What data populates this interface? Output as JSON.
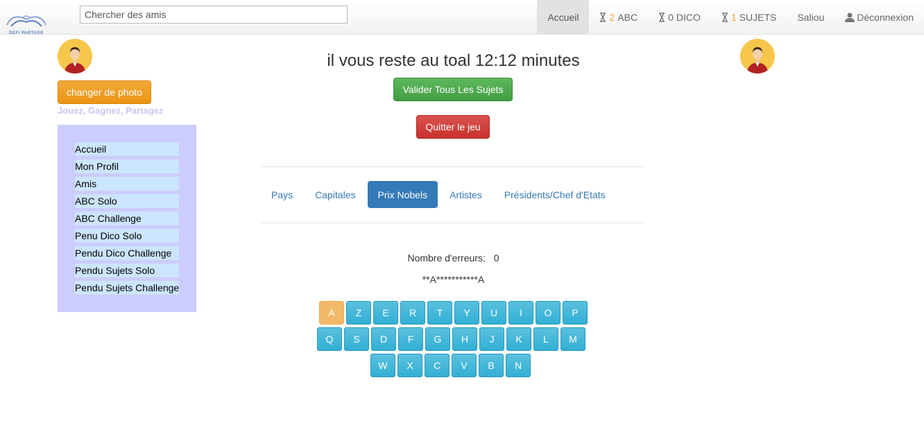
{
  "logo": {
    "text": "DEFI PARTAGE"
  },
  "search": {
    "placeholder": "Chercher des amis"
  },
  "nav": {
    "accueil": "Accueil",
    "abc_count": "2",
    "abc_label": "ABC",
    "dico_count": "0",
    "dico_label": "DICO",
    "sujets_count": "1",
    "sujets_label": "SUJETS",
    "user": "Saliou",
    "logout": "Déconnexion"
  },
  "profile": {
    "change_photo": "changer de photo",
    "tagline": "Jouez, Gagnez, Partagez"
  },
  "sidebar": {
    "items": [
      {
        "label": "Accueil"
      },
      {
        "label": "Mon Profil"
      },
      {
        "label": "Amis"
      },
      {
        "label": "ABC Solo"
      },
      {
        "label": "ABC Challenge"
      },
      {
        "label": "Penu Dico Solo"
      },
      {
        "label": "Pendu Dico Challenge"
      },
      {
        "label": "Pendu Sujets Solo"
      },
      {
        "label": "Pendu Sujets Challenge"
      }
    ]
  },
  "game": {
    "timer_text": "il vous reste au toal 12:12 minutes",
    "validate_label": "Valider Tous Les Sujets",
    "quit_label": "Quitter le jeu",
    "errors_label": "Nombre d'erreurs:",
    "errors_value": "0",
    "word": "**A***********A"
  },
  "tabs": [
    {
      "label": "Pays"
    },
    {
      "label": "Capitales"
    },
    {
      "label": "Prix Nobels",
      "active": true
    },
    {
      "label": "Artistes"
    },
    {
      "label": "Présidents/Chef d'Etats"
    }
  ],
  "keyboard": {
    "row1": [
      "A",
      "Z",
      "E",
      "R",
      "T",
      "Y",
      "U",
      "I",
      "O",
      "P"
    ],
    "row2": [
      "Q",
      "S",
      "D",
      "F",
      "G",
      "H",
      "J",
      "K",
      "L",
      "M"
    ],
    "row3": [
      "W",
      "X",
      "C",
      "V",
      "B",
      "N"
    ],
    "used": [
      "A"
    ]
  },
  "colors": {
    "accent": "#337ab7",
    "sidebar_bg": "#ccccff",
    "sidebar_item_bg": "#cce5ff",
    "key": "#5bc0de",
    "key_used": "#f0ad4e"
  }
}
